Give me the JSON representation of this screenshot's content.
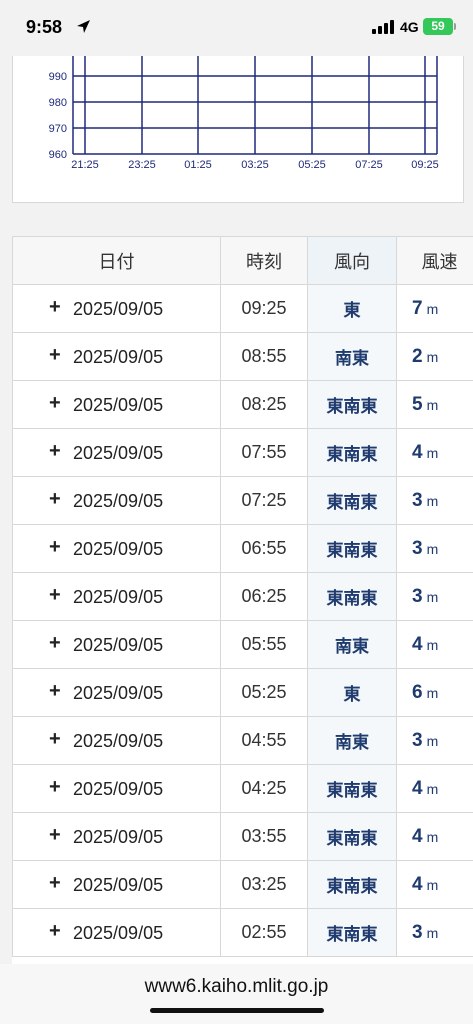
{
  "status_bar": {
    "time": "9:58",
    "network": "4G",
    "battery": "59"
  },
  "chart": {
    "y_ticks": [
      "990",
      "980",
      "970",
      "960"
    ],
    "x_ticks": [
      "21:25",
      "23:25",
      "01:25",
      "03:25",
      "05:25",
      "07:25",
      "09:25"
    ]
  },
  "table": {
    "headers": {
      "date": "日付",
      "time": "時刻",
      "direction": "風向",
      "speed": "風速"
    },
    "unit": "m",
    "rows": [
      {
        "date": "2025/09/05",
        "time": "09:25",
        "direction": "東",
        "speed": "7"
      },
      {
        "date": "2025/09/05",
        "time": "08:55",
        "direction": "南東",
        "speed": "2"
      },
      {
        "date": "2025/09/05",
        "time": "08:25",
        "direction": "東南東",
        "speed": "5"
      },
      {
        "date": "2025/09/05",
        "time": "07:55",
        "direction": "東南東",
        "speed": "4"
      },
      {
        "date": "2025/09/05",
        "time": "07:25",
        "direction": "東南東",
        "speed": "3"
      },
      {
        "date": "2025/09/05",
        "time": "06:55",
        "direction": "東南東",
        "speed": "3"
      },
      {
        "date": "2025/09/05",
        "time": "06:25",
        "direction": "東南東",
        "speed": "3"
      },
      {
        "date": "2025/09/05",
        "time": "05:55",
        "direction": "南東",
        "speed": "4"
      },
      {
        "date": "2025/09/05",
        "time": "05:25",
        "direction": "東",
        "speed": "6"
      },
      {
        "date": "2025/09/05",
        "time": "04:55",
        "direction": "南東",
        "speed": "3"
      },
      {
        "date": "2025/09/05",
        "time": "04:25",
        "direction": "東南東",
        "speed": "4"
      },
      {
        "date": "2025/09/05",
        "time": "03:55",
        "direction": "東南東",
        "speed": "4"
      },
      {
        "date": "2025/09/05",
        "time": "03:25",
        "direction": "東南東",
        "speed": "4"
      },
      {
        "date": "2025/09/05",
        "time": "02:55",
        "direction": "東南東",
        "speed": "3"
      }
    ]
  },
  "browser": {
    "url": "www6.kaiho.mlit.go.jp"
  },
  "colors": {
    "chart_line": "#1f2a7a",
    "direction_text": "#1f3b6e",
    "battery": "#34c759"
  }
}
